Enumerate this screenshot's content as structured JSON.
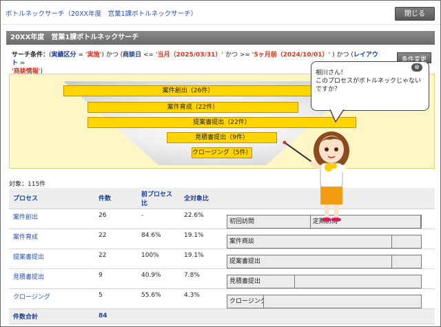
{
  "window": {
    "title": "ボトルネックサーチ（20XX年度　営業1課ボトルネックサーチ）",
    "close_label": "閉じる"
  },
  "section": {
    "title": "20XX年度　営業1課ボトルネックサーチ"
  },
  "conditions": {
    "label": "サーチ条件：",
    "p1_open": "(",
    "field1": "実績区分",
    "op1": " = ",
    "val1": "'実施'",
    "p1_close": ")",
    "and1": " かつ ",
    "p2_open": "(",
    "field2": "商談日",
    "op2": " <= ",
    "val2": "'当月（2025/03/31）'",
    "and2": " かつ >= ",
    "val3": "'5ヶ月前（2024/10/01）'",
    "p2_close": " )",
    "and3": " かつ ",
    "p3_open": "(",
    "field3": "レイアウト",
    "op3": " = ",
    "val4": "'商談情報'",
    "p3_close": ")",
    "change_label": "条件変更"
  },
  "funnel": {
    "bars": [
      {
        "label": "案件創出（26件）"
      },
      {
        "label": "案件育成（22件）"
      },
      {
        "label": "提案書提出（22件）"
      },
      {
        "label": "見積書提出（9件）"
      },
      {
        "label": "クロージング（5件）"
      }
    ]
  },
  "target_count": "対象：115件",
  "table": {
    "headers": [
      "プロセス",
      "件数",
      "前プロセス比",
      "全対象比"
    ],
    "rows": [
      {
        "process": "案件創出",
        "count": "26",
        "prev_ratio": "-",
        "total_ratio": "22.6%",
        "segments": [
          {
            "label": "初回訪問",
            "pct": 43
          },
          {
            "label": "定期訪問",
            "pct": 57
          }
        ]
      },
      {
        "process": "案件育成",
        "count": "22",
        "prev_ratio": "84.6%",
        "total_ratio": "19.1%",
        "segments": [
          {
            "label": "案件商談",
            "pct": 85
          }
        ]
      },
      {
        "process": "提案書提出",
        "count": "22",
        "prev_ratio": "100%",
        "total_ratio": "19.1%",
        "segments": [
          {
            "label": "提案書提出",
            "pct": 85
          }
        ]
      },
      {
        "process": "見積書提出",
        "count": "9",
        "prev_ratio": "40.9%",
        "total_ratio": "7.8%",
        "segments": [
          {
            "label": "見積書提出",
            "pct": 35
          }
        ]
      },
      {
        "process": "クロージング",
        "count": "5",
        "prev_ratio": "55.6%",
        "total_ratio": "4.3%",
        "segments": [
          {
            "label": "クロージング",
            "pct": 19
          }
        ]
      }
    ],
    "total_label": "件数合計",
    "total_value": "84"
  },
  "assistant": {
    "line1": "相川さん！",
    "line2": "このプロセスがボトルネックじゃないですか？",
    "close_symbol": "⊗"
  },
  "colors": {
    "funnel_bar": "#ffd400",
    "link": "#2a4fb3",
    "header_text": "#1b3f95",
    "condition_value": "#d8341a"
  }
}
